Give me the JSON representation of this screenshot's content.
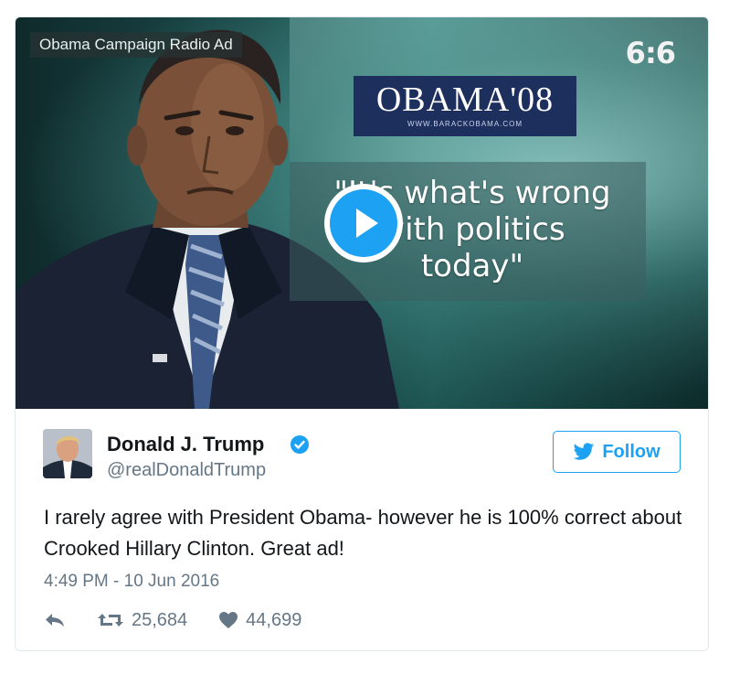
{
  "media": {
    "source_label": "Obama Campaign Radio Ad",
    "channel_logo": "6:6",
    "logo_title": "OBAMA'08",
    "logo_url": "WWW.BARACKOBAMA.COM",
    "quote_lines": [
      "\"It's what's wrong",
      "with politics",
      "today\""
    ],
    "play_icon": "play-icon"
  },
  "author": {
    "name": "Donald J. Trump",
    "handle": "@realDonaldTrump",
    "verified_icon": "verified-badge-icon"
  },
  "follow": {
    "label": "Follow",
    "icon": "twitter-bird-icon"
  },
  "tweet": {
    "text": "I rarely agree with President Obama- however he is 100% correct about Crooked Hillary Clinton. Great ad!",
    "timestamp": "4:49 PM - 10 Jun 2016"
  },
  "actions": {
    "reply_icon": "reply-icon",
    "retweet_icon": "retweet-icon",
    "retweets": "25,684",
    "like_icon": "heart-icon",
    "likes": "44,699"
  },
  "colors": {
    "accent": "#1da1f2",
    "secondary_text": "#657786",
    "primary_text": "#14171a"
  }
}
